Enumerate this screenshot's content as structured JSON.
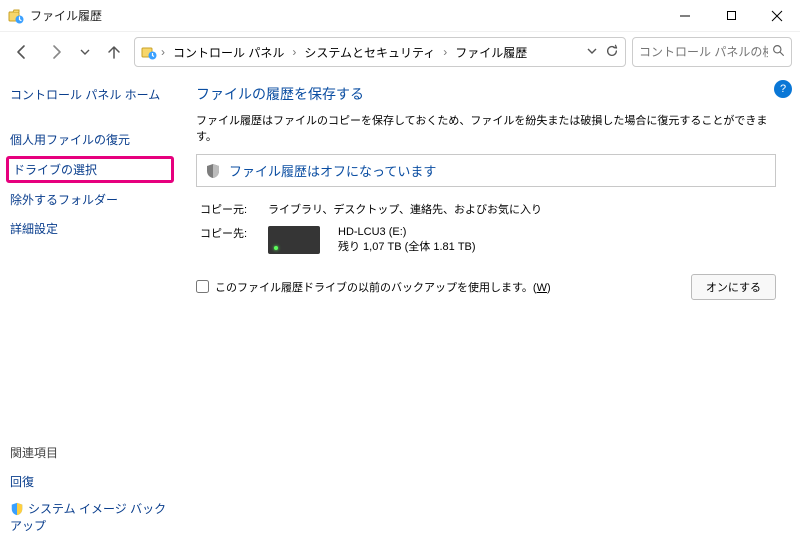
{
  "window": {
    "title": "ファイル履歴"
  },
  "breadcrumbs": {
    "b1": "コントロール パネル",
    "b2": "システムとセキュリティ",
    "b3": "ファイル履歴"
  },
  "search": {
    "placeholder": "コントロール パネルの検索"
  },
  "sidebar": {
    "home": "コントロール パネル ホーム",
    "restore": "個人用ファイルの復元",
    "selectDrive": "ドライブの選択",
    "exclude": "除外するフォルダー",
    "advanced": "詳細設定"
  },
  "related": {
    "heading": "関連項目",
    "recovery": "回復",
    "sysimage": "システム イメージ バックアップ"
  },
  "main": {
    "heading": "ファイルの履歴を保存する",
    "description": "ファイル履歴はファイルのコピーを保存しておくため、ファイルを紛失または破損した場合に復元することができます。",
    "statusText": "ファイル履歴はオフになっています",
    "srcLabel": "コピー元:",
    "srcValue": "ライブラリ、デスクトップ、連絡先、およびお気に入り",
    "dstLabel": "コピー先:",
    "driveName": "HD-LCU3 (E:)",
    "driveSpace": "残り 1,07 TB (全体 1.81 TB)",
    "reuseLabelA": "このファイル履歴ドライブの以前のバックアップを使用します。(",
    "reuseHotkey": "W",
    "reuseLabelB": ")",
    "turnOn": "オンにする"
  }
}
